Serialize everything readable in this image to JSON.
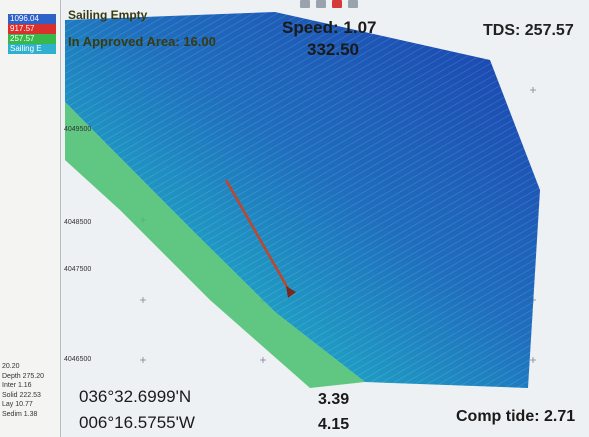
{
  "header": {
    "title": "Sailing Empty",
    "area_line": "In Approved Area: 16.00",
    "speed": "Speed: 1.07",
    "heading": "332.50",
    "tds": "TDS: 257.57"
  },
  "legend": {
    "items": [
      {
        "label": "1096.04",
        "color": "#2f62c8"
      },
      {
        "label": "917.57",
        "color": "#d9302d"
      },
      {
        "label": "257.57",
        "color": "#38b84a"
      },
      {
        "label": "Sailing E",
        "color": "#2fb0cf"
      }
    ]
  },
  "stats": {
    "rows": [
      "20.20",
      "Depth 275.20",
      "Inter 1.16",
      "Solid 222.53",
      "Lay 10.77",
      "Sedim 1.38"
    ]
  },
  "position": {
    "lat": "036°32.6999'N",
    "lon": "006°16.5755'W"
  },
  "depth": {
    "value1": "3.39",
    "value2": "4.15"
  },
  "tide": "Comp tide: 2.71",
  "grid_labels": [
    "4049500",
    "4048500",
    "4047500",
    "4046500"
  ],
  "colors": {
    "deep": "#1b3fae",
    "mid": "#1f8fc4",
    "shallow": "#44c37a",
    "track": "#c0462b",
    "background": "#eef1f3"
  }
}
